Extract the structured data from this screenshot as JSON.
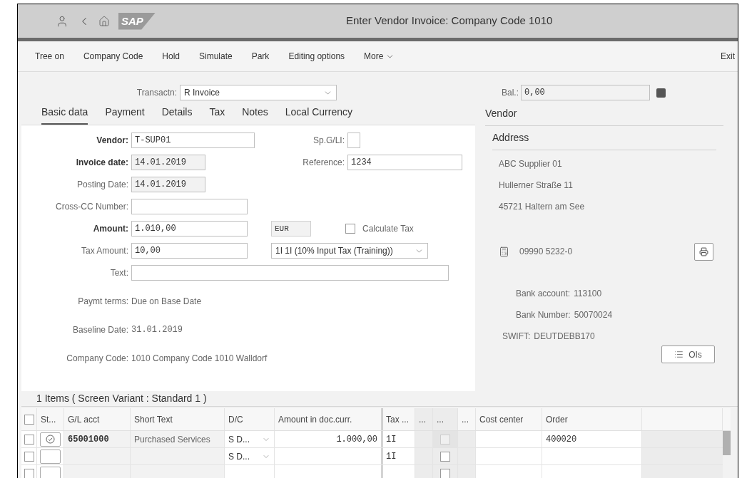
{
  "header": {
    "logo": "SAP",
    "title": "Enter Vendor Invoice: Company Code 1010"
  },
  "toolbar": {
    "items": [
      "Tree on",
      "Company Code",
      "Hold",
      "Simulate",
      "Park",
      "Editing options"
    ],
    "more": "More",
    "exit": "Exit"
  },
  "transaction": {
    "label": "Transactn:",
    "value": "R Invoice"
  },
  "tabs": [
    {
      "label": "Basic data",
      "selected": true
    },
    {
      "label": "Payment",
      "selected": false
    },
    {
      "label": "Details",
      "selected": false
    },
    {
      "label": "Tax",
      "selected": false
    },
    {
      "label": "Notes",
      "selected": false
    },
    {
      "label": "Local Currency",
      "selected": false
    }
  ],
  "form": {
    "vendor": {
      "label": "Vendor:",
      "value": "T-SUP01",
      "required": true
    },
    "sp_gl": {
      "label": "Sp.G/LI:"
    },
    "invoice_date": {
      "label": "Invoice date:",
      "value": "14.01.2019",
      "required": true
    },
    "reference": {
      "label": "Reference:",
      "value": "1234"
    },
    "posting_date": {
      "label": "Posting Date:",
      "value": "14.01.2019",
      "required": false
    },
    "cross_cc": {
      "label": "Cross-CC Number:"
    },
    "amount": {
      "label": "Amount:",
      "value": "1.010,00",
      "required": true
    },
    "currency": {
      "value": "EUR"
    },
    "calculate_tax": {
      "label": "Calculate Tax",
      "checked": false
    },
    "tax_amount": {
      "label": "Tax Amount:",
      "value": "10,00",
      "required": false
    },
    "tax_code": {
      "value": "1I 1I (10% Input Tax (Training))"
    },
    "text": {
      "label": "Text:"
    },
    "payment_terms": {
      "label": "Paymt terms:",
      "value": "Due on Base Date"
    },
    "baseline_date": {
      "label": "Baseline Date:",
      "value": "31.01.2019"
    },
    "company_code": {
      "label": "Company Code:",
      "value": "1010 Company Code 1010 Walldorf"
    }
  },
  "balance": {
    "label": "Bal.:",
    "value": "0,00"
  },
  "vendor_panel": {
    "title": "Vendor",
    "section": "Address",
    "address_lines": [
      "ABC Supplier 01",
      "Hullerner Straße 11",
      "45721 Haltern am See"
    ],
    "phone": "09990 5232-0",
    "bank": [
      {
        "label": "Bank account:",
        "value": "113100"
      },
      {
        "label": "Bank Number:",
        "value": "50070024"
      },
      {
        "label": "SWIFT:",
        "value": "DEUTDEBB170"
      }
    ],
    "ois_button": "OIs"
  },
  "items": {
    "title": "1 Items ( Screen Variant : Standard 1 )",
    "all_selected": false,
    "columns": [
      "St...",
      "G/L acct",
      "Short Text",
      "D/C",
      "Amount in doc.curr.",
      "Tax ...",
      "...",
      "...",
      "...",
      "Cost center",
      "Order"
    ],
    "rows": [
      {
        "selected": false,
        "done": true,
        "gl_account": "65001000",
        "short_text": "Purchased Services",
        "dc": "S D...",
        "amount": "1.000,00",
        "tax": "1I",
        "flag_checked": false,
        "flag_disabled": true,
        "order": "400020"
      },
      {
        "selected": false,
        "done": false,
        "dc": "S D...",
        "tax": "1I",
        "flag_checked": false,
        "flag_disabled": false
      },
      {
        "selected": false,
        "done": false,
        "flag_checked": false,
        "flag_disabled": false
      }
    ]
  }
}
